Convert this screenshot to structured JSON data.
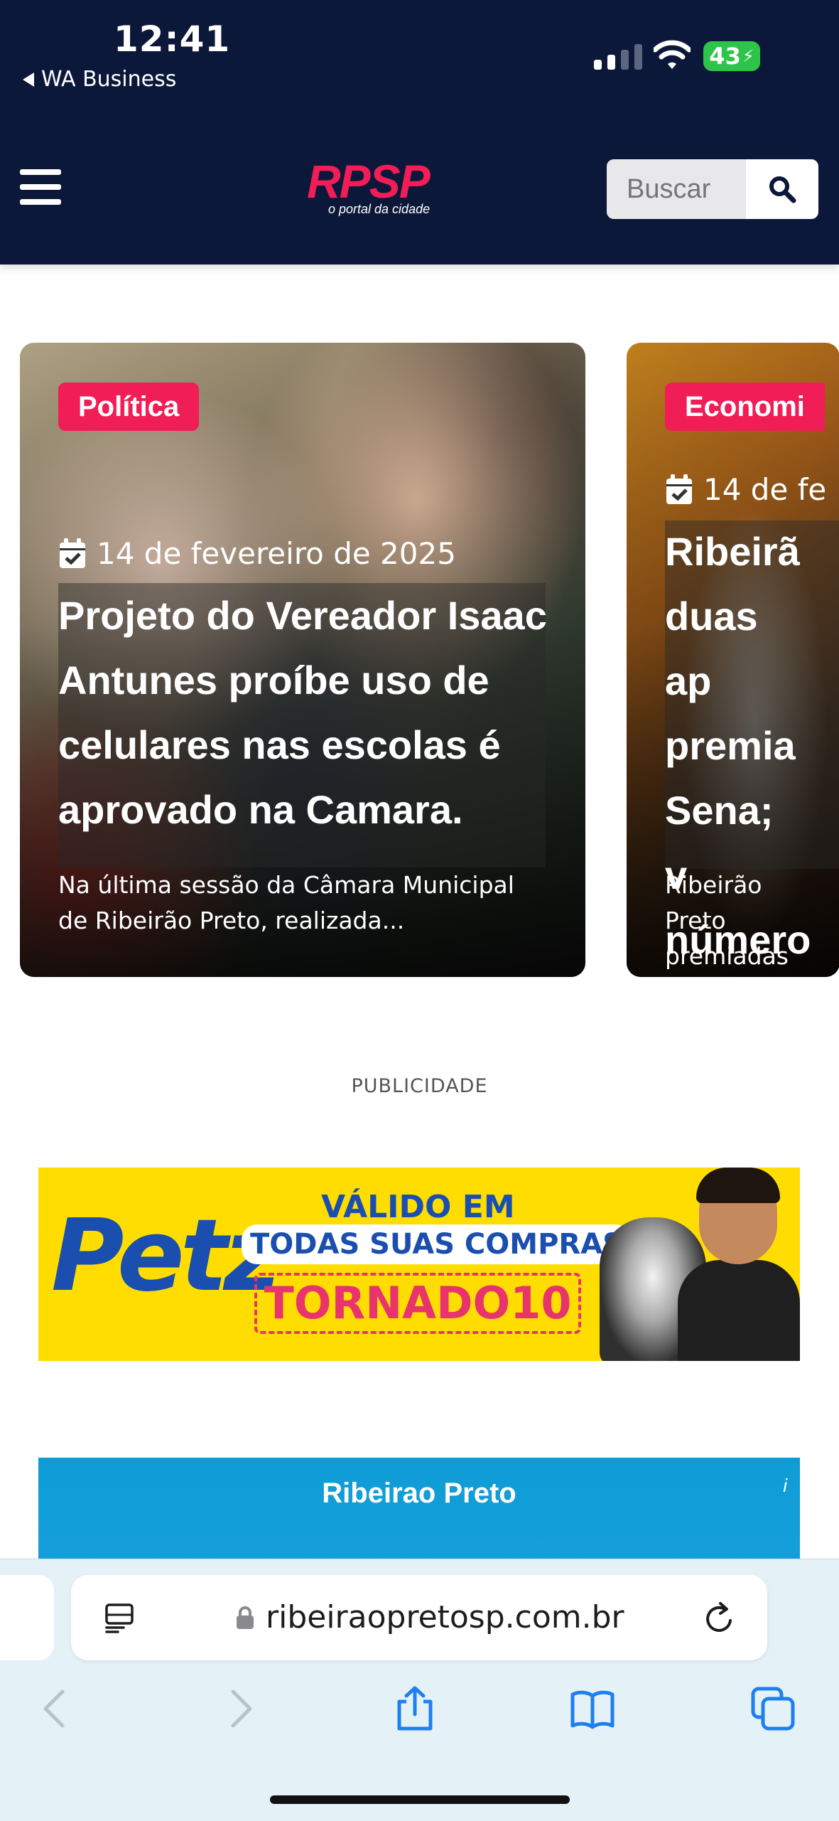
{
  "status_bar": {
    "time": "12:41",
    "back_app": "WA Business",
    "battery": "43"
  },
  "header": {
    "logo_text": "RPSP",
    "logo_subtitle": "o portal da cidade",
    "search_placeholder": "Buscar",
    "icons": [
      "hamburger-icon",
      "search-icon"
    ],
    "colors": {
      "background": "#0c1839",
      "accent": "#f01d56"
    }
  },
  "carousel": {
    "cards": [
      {
        "category": "Política",
        "date": "14 de fevereiro de 2025",
        "title": "Projeto do Vereador Isaac Antunes proíbe uso de celulares nas escolas é aprovado na Camara.",
        "excerpt": "Na última sessão da Câmara Municipal de Ribeirão Preto, realizada..."
      },
      {
        "category": "Economi",
        "date": "14 de fe",
        "title": "Ribeirã duas ap premia Sena; v número",
        "excerpt": "Ribeirão Preto premiadas na"
      }
    ]
  },
  "advertising": {
    "label": "PUBLICIDADE",
    "banner": {
      "brand": "Petz",
      "line1": "VÁLIDO EM",
      "line2": "TODAS SUAS COMPRAS",
      "code": "TORNADO10"
    }
  },
  "weather_widget": {
    "city": "Ribeirao Preto"
  },
  "browser": {
    "url": "ribeiraopretosp.com.br",
    "icons": [
      "reader-icon",
      "lock-icon",
      "reload-icon",
      "back-icon",
      "forward-icon",
      "share-icon",
      "bookmarks-icon",
      "tabs-icon"
    ]
  }
}
